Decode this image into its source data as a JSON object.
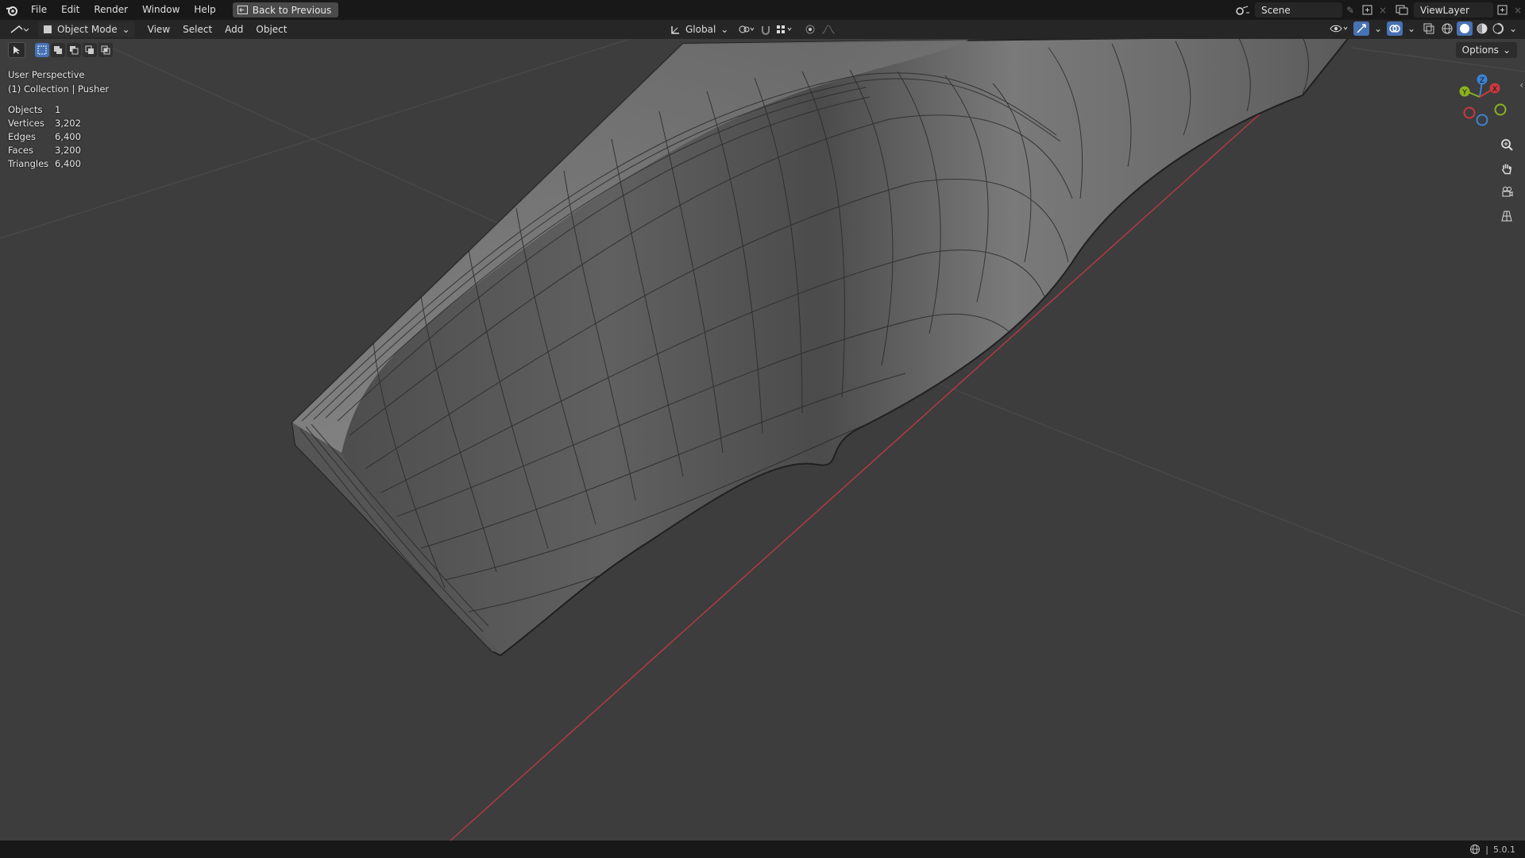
{
  "menubar": {
    "items": [
      "File",
      "Edit",
      "Render",
      "Window",
      "Help"
    ],
    "back_label": "Back to Previous",
    "scene": "Scene",
    "view_layer": "ViewLayer"
  },
  "header": {
    "mode": "Object Mode",
    "menus": [
      "View",
      "Select",
      "Add",
      "Object"
    ],
    "transform_orientation": "Global"
  },
  "viewport": {
    "perspective": "User Perspective",
    "collection": "(1) Collection | Pusher",
    "options_label": "Options",
    "stats": [
      {
        "label": "Objects",
        "value": "1"
      },
      {
        "label": "Vertices",
        "value": "3,202"
      },
      {
        "label": "Edges",
        "value": "6,400"
      },
      {
        "label": "Faces",
        "value": "3,200"
      },
      {
        "label": "Triangles",
        "value": "6,400"
      }
    ],
    "gizmo": {
      "x": "X",
      "y": "Y",
      "z": "Z"
    },
    "colors": {
      "x_axis": "#c8393f",
      "y_axis": "#8ab321",
      "z_axis": "#3b84d6",
      "accent": "#4772b3"
    }
  },
  "status": {
    "version": "5.0.1"
  }
}
